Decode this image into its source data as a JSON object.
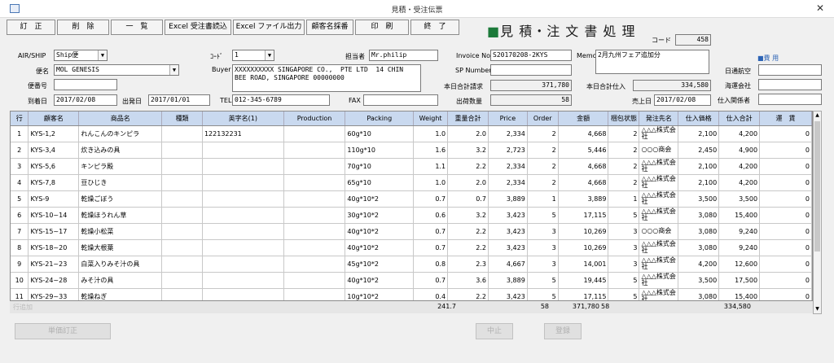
{
  "window": {
    "title": "見積・受注伝票"
  },
  "toolbar": [
    "訂　正",
    "削　除",
    "一　覧",
    "Excel 受注書読込",
    "Excel ファイル出力",
    "顧客名採番",
    "印　刷",
    "終　了"
  ],
  "heading": {
    "square": "■",
    "text": "見 積・注 文 書 処 理"
  },
  "code_label": "コード",
  "code_value": "458",
  "form": {
    "airship_label": "AIR/SHIP",
    "airship_value": "Ship便",
    "vessel_label": "便名",
    "vessel_value": "MOL GENESIS",
    "flight_no_label": "便番号",
    "flight_no_value": "",
    "arrival_label": "到着日",
    "arrival_value": "2017/02/08",
    "departure_label": "出発日",
    "departure_value": "2017/01/01",
    "code2_label": "ｺｰﾄﾞ",
    "code2_value": "1",
    "buyer_label": "Buyer",
    "buyer_value": "XXXXXXXXXX SINGAPORE CO.,  PTE LTD  14 CHIN\nBEE ROAD, SINGAPORE 00000000",
    "tel_label": "TEL",
    "tel_value": "012-345-6789",
    "fax_label": "FAX",
    "fax_value": "",
    "staff_label": "担当者",
    "staff_value": "Mr.philip",
    "invoice_label": "Invoice No",
    "invoice_value": "S20170208-2KYS",
    "sp_label": "SP Number",
    "sp_value": "",
    "today_billing_label": "本日合計請求",
    "today_billing_value": "371,780",
    "ship_qty_label": "出荷数量",
    "ship_qty_value": "58",
    "memo_label": "Memo",
    "memo_value": "2月九州フェア追加分",
    "today_purchase_label": "本日合計仕入",
    "today_purchase_value": "334,580",
    "sales_date_label": "売上日",
    "sales_date_value": "2017/02/08",
    "fee_label": "■費 用",
    "nittsu_label": "日通航空",
    "nittsu_value": "",
    "kaiun_label": "海運会社",
    "kaiun_value": "",
    "shiire_label": "仕入関係者",
    "shiire_value": ""
  },
  "table": {
    "headers": [
      "行",
      "顧客名",
      "商品名",
      "種類",
      "英字名(1)",
      "Production",
      "Packing",
      "Weight",
      "重量合計",
      "Price",
      "Order",
      "金額",
      "梱包状態",
      "発注先名",
      "仕入価格",
      "仕入合計",
      "運　賃"
    ],
    "rows": [
      [
        "1",
        "KYS-1,2",
        "れんこんのキンピラ",
        "",
        "122132231",
        "",
        "60g*10",
        "1.0",
        "2.0",
        "2,334",
        "2",
        "4,668",
        "2",
        "△△△株式会社",
        "2,100",
        "4,200",
        "0"
      ],
      [
        "2",
        "KYS-3,4",
        "炊き込みの具",
        "",
        "",
        "",
        "110g*10",
        "1.6",
        "3.2",
        "2,723",
        "2",
        "5,446",
        "2",
        "○○○商会",
        "2,450",
        "4,900",
        "0"
      ],
      [
        "3",
        "KYS-5,6",
        "キンピラ殿",
        "",
        "",
        "",
        "70g*10",
        "1.1",
        "2.2",
        "2,334",
        "2",
        "4,668",
        "2",
        "△△△株式会社",
        "2,100",
        "4,200",
        "0"
      ],
      [
        "4",
        "KYS-7,8",
        "豆ひじき",
        "",
        "",
        "",
        "65g*10",
        "1.0",
        "2.0",
        "2,334",
        "2",
        "4,668",
        "2",
        "△△△株式会社",
        "2,100",
        "4,200",
        "0"
      ],
      [
        "5",
        "KYS-9",
        "乾燥ごぼう",
        "",
        "",
        "",
        "40g*10*2",
        "0.7",
        "0.7",
        "3,889",
        "1",
        "3,889",
        "1",
        "△△△株式会社",
        "3,500",
        "3,500",
        "0"
      ],
      [
        "6",
        "KYS-10~14",
        "乾燥ほうれん草",
        "",
        "",
        "",
        "30g*10*2",
        "0.6",
        "3.2",
        "3,423",
        "5",
        "17,115",
        "5",
        "△△△株式会社",
        "3,080",
        "15,400",
        "0"
      ],
      [
        "7",
        "KYS-15~17",
        "乾燥小松菜",
        "",
        "",
        "",
        "40g*10*2",
        "0.7",
        "2.2",
        "3,423",
        "3",
        "10,269",
        "3",
        "○○○商会",
        "3,080",
        "9,240",
        "0"
      ],
      [
        "8",
        "KYS-18~20",
        "乾燥大根葉",
        "",
        "",
        "",
        "40g*10*2",
        "0.7",
        "2.2",
        "3,423",
        "3",
        "10,269",
        "3",
        "△△△株式会社",
        "3,080",
        "9,240",
        "0"
      ],
      [
        "9",
        "KYS-21~23",
        "白菜入りみそ汁の具",
        "",
        "",
        "",
        "45g*10*2",
        "0.8",
        "2.3",
        "4,667",
        "3",
        "14,001",
        "3",
        "△△△株式会社",
        "4,200",
        "12,600",
        "0"
      ],
      [
        "10",
        "KYS-24~28",
        "みそ汁の具",
        "",
        "",
        "",
        "40g*10*2",
        "0.7",
        "3.6",
        "3,889",
        "5",
        "19,445",
        "5",
        "△△△株式会社",
        "3,500",
        "17,500",
        "0"
      ],
      [
        "11",
        "KYS-29~33",
        "乾燥ねぎ",
        "",
        "",
        "",
        "10g*10*2",
        "0.4",
        "2.2",
        "3,423",
        "5",
        "17,115",
        "5",
        "△△△株式会社",
        "3,080",
        "15,400",
        "0"
      ]
    ]
  },
  "totals": {
    "label": "行追加",
    "weight_total": "241.7",
    "order_total": "58",
    "amount_total": "371,780",
    "pack_total": "58",
    "purchase_total": "334,580"
  },
  "bottom": {
    "batch_edit": "単価訂正",
    "cancel": "中止",
    "register": "登録"
  }
}
